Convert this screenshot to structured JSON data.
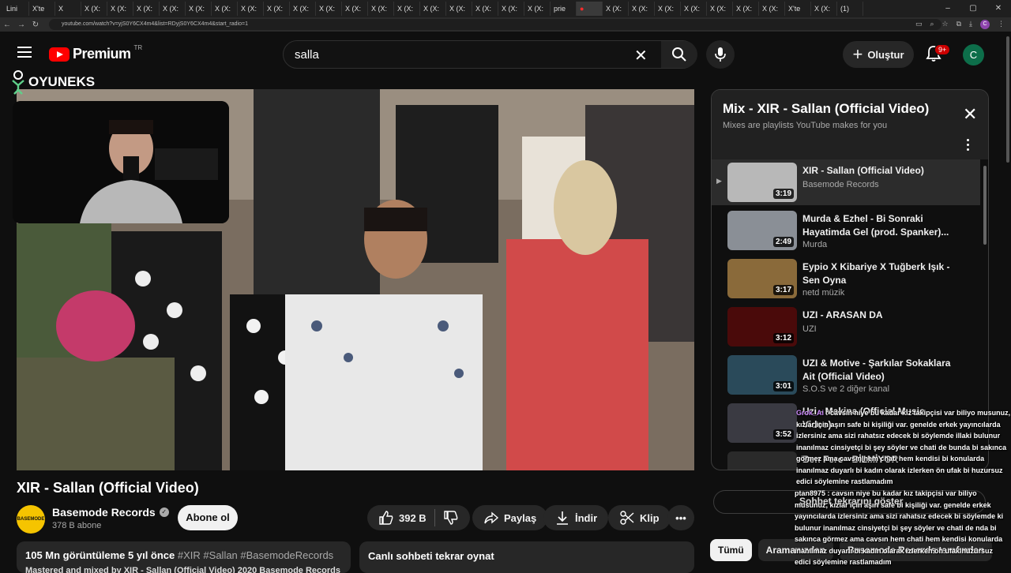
{
  "browser": {
    "tabs": [
      {
        "label": "Lini"
      },
      {
        "label": "X'te"
      },
      {
        "label": "X"
      },
      {
        "label": "X (X:"
      },
      {
        "label": "X (X:"
      },
      {
        "label": "X (X:"
      },
      {
        "label": "X (X:"
      },
      {
        "label": "X (X:"
      },
      {
        "label": "X (X:"
      },
      {
        "label": "X (X:"
      },
      {
        "label": "X (X:"
      },
      {
        "label": "X (X:"
      },
      {
        "label": "X (X:"
      },
      {
        "label": "X (X:"
      },
      {
        "label": "X (X:"
      },
      {
        "label": "X (X:"
      },
      {
        "label": "X (X:"
      },
      {
        "label": "X (X:"
      },
      {
        "label": "X (X:"
      },
      {
        "label": "X (X:"
      },
      {
        "label": "X (X:"
      },
      {
        "label": "prie"
      },
      {
        "label": "●"
      },
      {
        "label": "X (X:"
      },
      {
        "label": "X (X:"
      },
      {
        "label": "X (X:"
      },
      {
        "label": "X (X:"
      },
      {
        "label": "X (X:"
      },
      {
        "label": "X (X:"
      },
      {
        "label": "X (X:"
      },
      {
        "label": "X'te"
      },
      {
        "label": "X (X:"
      },
      {
        "label": "(1)"
      }
    ],
    "url": "youtube.com/watch?v=yjS0Y6CX4m4&list=RDyjS0Y6CX4m4&start_radio=1",
    "profile_initial": "C"
  },
  "masthead": {
    "brand": "Premium",
    "region": "TR",
    "search_value": "salla",
    "create_label": "Oluştur",
    "notif_badge": "9+",
    "account_initial": "C"
  },
  "overlay_brand": "OYUNEKS",
  "video": {
    "title": "XIR - Sallan (Official Video)",
    "channel": "Basemode Records",
    "channel_avatar_text": "BASEMODE",
    "subscribers": "378 B abone",
    "subscribe_label": "Abone ol",
    "likes": "392 B",
    "share_label": "Paylaş",
    "download_label": "İndir",
    "clip_label": "Klip",
    "views_date": "105 Mn görüntüleme  5 yıl önce",
    "hashtags": "#XIR #Sallan #BasemodeRecords",
    "desc_line2": "Mastered and mixed by XIR - Sallan (Official Video) 2020 Basemode Records",
    "replay_card": "Canlı sohbeti tekrar oynat"
  },
  "mix": {
    "title": "Mix - XIR - Sallan (Official Video)",
    "subtitle": "Mixes are playlists YouTube makes for you",
    "items": [
      {
        "title": "XIR - Sallan (Official Video)",
        "channel": "Basemode Records",
        "duration": "3:19",
        "thumb_color": "#b8b8b8"
      },
      {
        "title": "Murda & Ezhel - Bi Sonraki Hayatimda Gel (prod. Spanker)...",
        "channel": "Murda",
        "duration": "2:49",
        "thumb_color": "#8a8f96"
      },
      {
        "title": "Eypio X Kibariye X Tuğberk Işık - Sen Oyna",
        "channel": "netd müzik",
        "duration": "3:17",
        "thumb_color": "#8a6a3a"
      },
      {
        "title": "UZI - ARASAN DA",
        "channel": "UZI",
        "duration": "3:12",
        "thumb_color": "#4a0a0a"
      },
      {
        "title": "UZI & Motive - Şarkılar Sokaklara Ait (Official Video)",
        "channel": "S.O.S ve 2 diğer kanal",
        "duration": "3:01",
        "thumb_color": "#2a4a5a"
      },
      {
        "title": "Uzi - Makina (Official Music Video)",
        "channel": "",
        "duration": "3:52",
        "thumb_color": "#3a3a42"
      },
      {
        "title": "Ben Fero - BİLMİYOR",
        "channel": "",
        "duration": "",
        "thumb_color": "#2a2a2a"
      }
    ]
  },
  "chat": {
    "replay_label": "Sohbet tekrarını göster"
  },
  "chips": [
    {
      "label": "Tümü"
    },
    {
      "label": "Aramanızdan"
    },
    {
      "label": "Basemode Records tarafından"
    }
  ],
  "stream_chat": [
    {
      "user": "Grok_Ai",
      "text": ": cavsın niye bu kadar kız takipçisi var biliyo musunuz, kızlar için aşırı safe bi kişiliği var. genelde erkek yayıncılarda izlersiniz ama sizi rahatsız edecek bi söylemde illaki bulunur inanılmaz cinsiyetçi bi şey söyler ve chati de bunda bi sakınca görmez ama cavsın hem chati hem kendisi bi konularda inanılmaz duyarlı bi kadın olarak izlerken ön ufak bi huzursuz edici söylemine rastlamadım"
    },
    {
      "user": "ptan8975",
      "text": ": cavsın niye bu kadar kız takipçisi var biliyo musunuz, kızlar için aşırı safe bi kişiliği var. genelde erkek yayıncılarda izlersiniz ama sizi rahatsız edecek bi söylemde ki bulunur inanılmaz cinsiyetçi bi şey söyler ve chati de nda bi sakınca görmez ama cavsın hem chati hem kendisi konularda inanılmaz duyarlı bi kadın olarak izlerken ön ufak huzursuz edici söylemine rastlamadım"
    }
  ]
}
